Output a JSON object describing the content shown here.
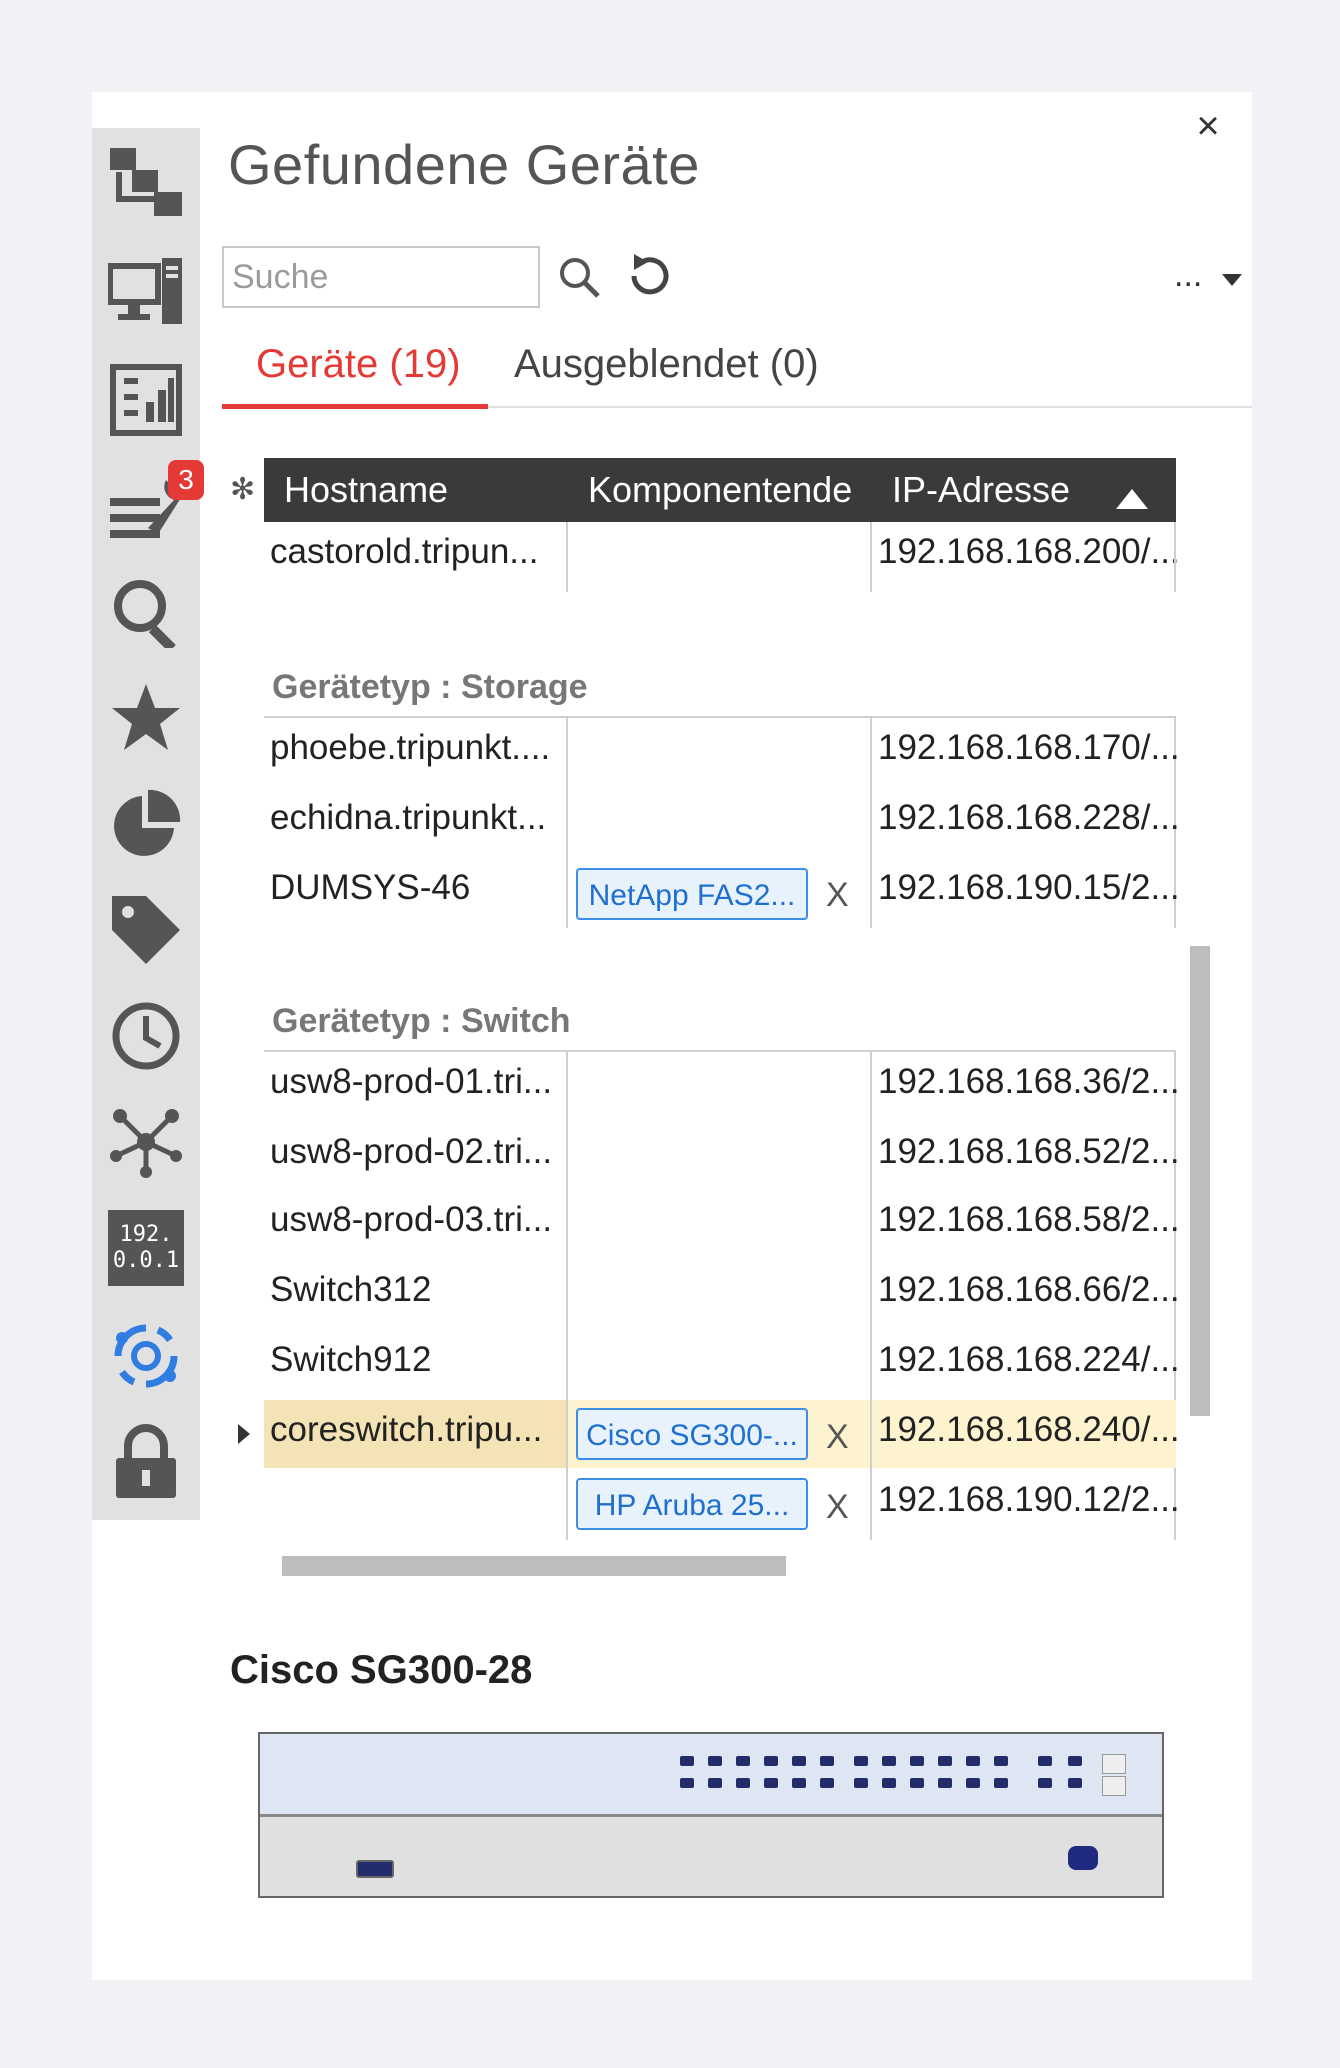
{
  "panel": {
    "title": "Gefundene Geräte",
    "close_symbol": "×"
  },
  "sidebar": {
    "items": [
      {
        "icon": "topology-icon"
      },
      {
        "icon": "devices-icon"
      },
      {
        "icon": "dashboard-icon"
      },
      {
        "icon": "tools-icon",
        "badge": "3"
      },
      {
        "icon": "search-icon"
      },
      {
        "icon": "star-icon"
      },
      {
        "icon": "pie-chart-icon"
      },
      {
        "icon": "tag-icon"
      },
      {
        "icon": "clock-icon"
      },
      {
        "icon": "network-icon"
      },
      {
        "icon": "ip-icon",
        "text_line1": "192.",
        "text_line2": "0.0.1"
      },
      {
        "icon": "discovery-icon",
        "active": true
      },
      {
        "icon": "lock-icon"
      }
    ]
  },
  "search": {
    "placeholder": "Suche"
  },
  "toolbar": {
    "more_label": "..."
  },
  "tabs": [
    {
      "label": "Geräte (19)",
      "active": true
    },
    {
      "label": "Ausgeblendet (0)",
      "active": false
    }
  ],
  "grid": {
    "columns": [
      "Hostname",
      "Komponentende",
      "IP-Adresse"
    ],
    "sort_indicator": "ascending",
    "top_rows": [
      {
        "hostname": "castorold.tripun...",
        "component": "",
        "ip": "192.168.168.200/..."
      }
    ],
    "groups": [
      {
        "title": "Gerätetyp : Storage",
        "rows": [
          {
            "hostname": "phoebe.tripunkt....",
            "component": "",
            "ip": "192.168.168.170/..."
          },
          {
            "hostname": "echidna.tripunkt...",
            "component": "",
            "ip": "192.168.168.228/..."
          },
          {
            "hostname": "DUMSYS-46",
            "component": "NetApp FAS2...",
            "remove": "X",
            "ip": "192.168.190.15/2..."
          }
        ]
      },
      {
        "title": "Gerätetyp : Switch",
        "rows": [
          {
            "hostname": "usw8-prod-01.tri...",
            "component": "",
            "ip": "192.168.168.36/2..."
          },
          {
            "hostname": "usw8-prod-02.tri...",
            "component": "",
            "ip": "192.168.168.52/2..."
          },
          {
            "hostname": "usw8-prod-03.tri...",
            "component": "",
            "ip": "192.168.168.58/2..."
          },
          {
            "hostname": "Switch312",
            "component": "",
            "ip": "192.168.168.66/2..."
          },
          {
            "hostname": "Switch912",
            "component": "",
            "ip": "192.168.168.224/..."
          },
          {
            "hostname": "coreswitch.tripu...",
            "component": "Cisco SG300-...",
            "remove": "X",
            "ip": "192.168.168.240/...",
            "selected": true
          },
          {
            "hostname": "",
            "component": "HP Aruba 25...",
            "remove": "X",
            "ip": "192.168.190.12/2..."
          }
        ]
      }
    ]
  },
  "detail": {
    "title": "Cisco SG300-28"
  }
}
